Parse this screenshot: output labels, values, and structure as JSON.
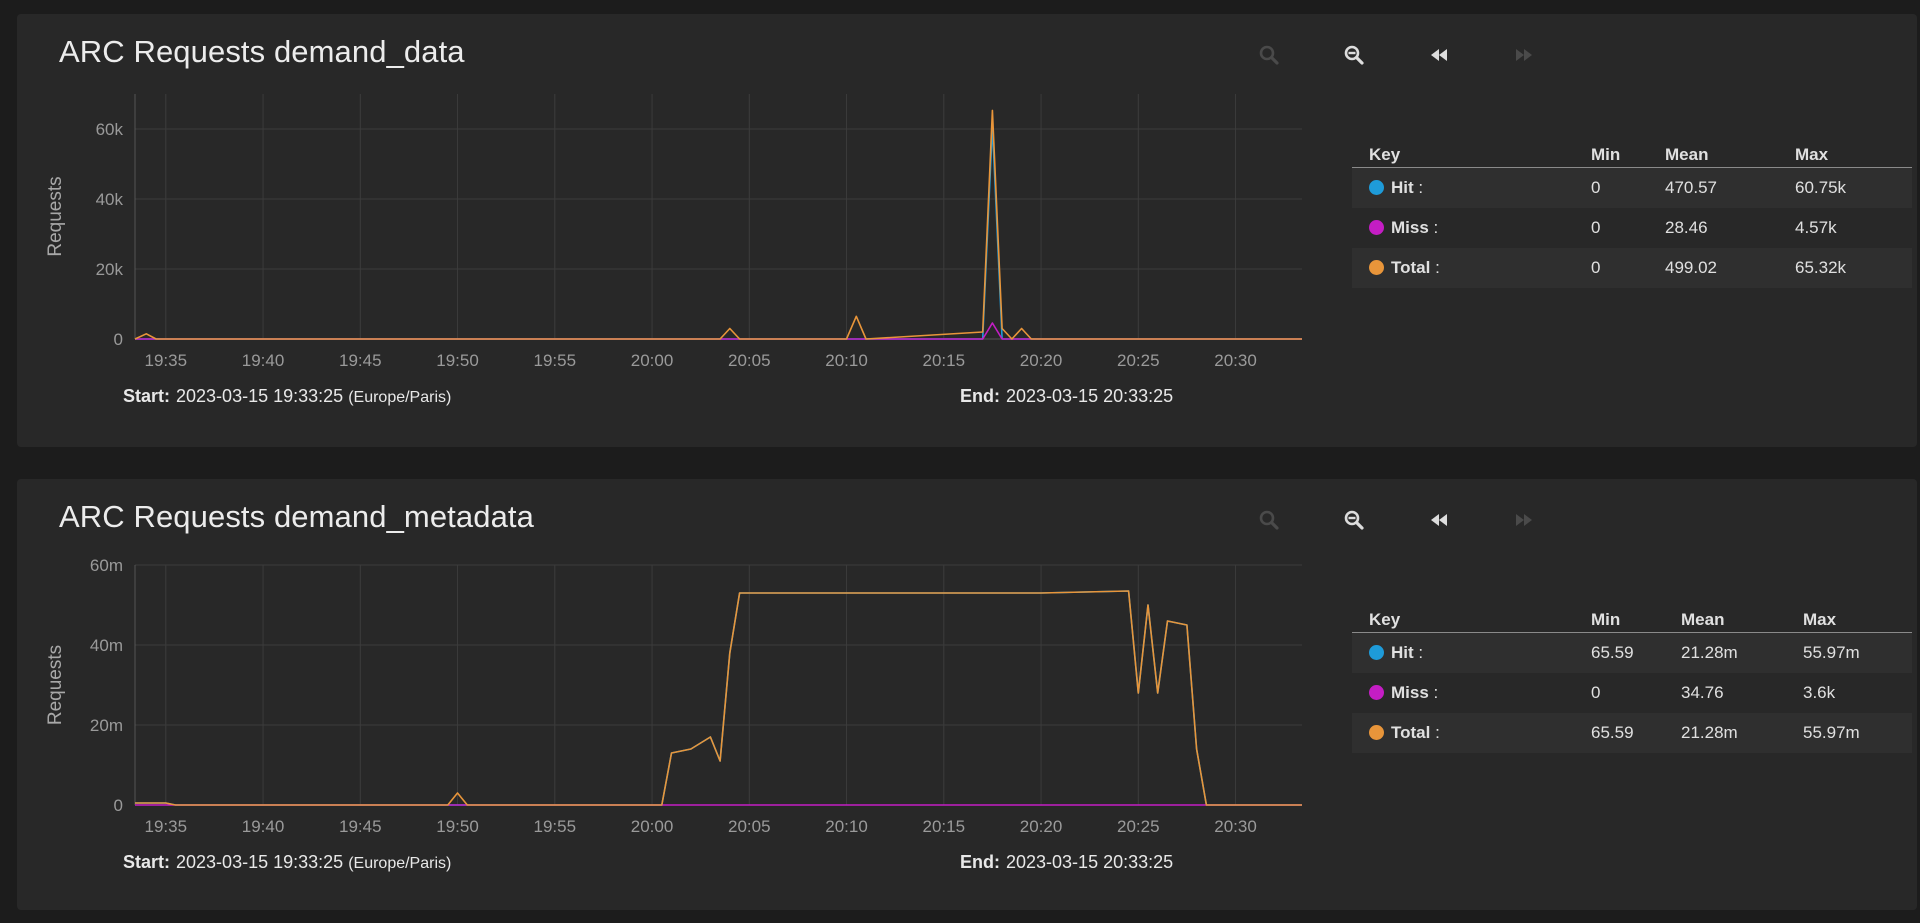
{
  "colors": {
    "hit": "#1e9bd9",
    "miss": "#c41dc4",
    "total": "#e8953a",
    "grid": "#3c3c3c",
    "axis": "#555555"
  },
  "charts": [
    {
      "title": "ARC Requests demand_data",
      "ylabel": "Requests",
      "start_label": "Start:",
      "start": "2023-03-15 19:33:25",
      "timezone": "(Europe/Paris)",
      "end_label": "End:",
      "end": "2023-03-15 20:33:25",
      "legend": {
        "headers": [
          "Key",
          "Min",
          "Mean",
          "Max"
        ],
        "rows": [
          {
            "name": "Hit",
            "min": "0",
            "mean": "470.57",
            "max": "60.75k"
          },
          {
            "name": "Miss",
            "min": "0",
            "mean": "28.46",
            "max": "4.57k"
          },
          {
            "name": "Total",
            "min": "0",
            "mean": "499.02",
            "max": "65.32k"
          }
        ]
      }
    },
    {
      "title": "ARC Requests demand_metadata",
      "ylabel": "Requests",
      "start_label": "Start:",
      "start": "2023-03-15 19:33:25",
      "timezone": "(Europe/Paris)",
      "end_label": "End:",
      "end": "2023-03-15 20:33:25",
      "legend": {
        "headers": [
          "Key",
          "Min",
          "Mean",
          "Max"
        ],
        "rows": [
          {
            "name": "Hit",
            "min": "65.59",
            "mean": "21.28m",
            "max": "55.97m"
          },
          {
            "name": "Miss",
            "min": "0",
            "mean": "34.76",
            "max": "3.6k"
          },
          {
            "name": "Total",
            "min": "65.59",
            "mean": "21.28m",
            "max": "55.97m"
          }
        ]
      }
    }
  ],
  "chart_data": [
    {
      "type": "line",
      "title": "ARC Requests demand_data",
      "ylabel": "Requests",
      "x_range": [
        "19:33:25",
        "20:33:25"
      ],
      "ylim": [
        0,
        70000
      ],
      "yticks": [
        0,
        20000,
        40000,
        60000
      ],
      "ytick_labels": [
        "0",
        "20k",
        "40k",
        "60k"
      ],
      "xtick_labels": [
        "19:35",
        "19:40",
        "19:45",
        "19:50",
        "19:55",
        "20:00",
        "20:05",
        "20:10",
        "20:15",
        "20:20",
        "20:25",
        "20:30"
      ],
      "grid": true,
      "series": [
        {
          "name": "Hit",
          "points": [
            [
              "19:33:25",
              0
            ],
            [
              "20:17:00",
              0
            ],
            [
              "20:17:30",
              60750
            ],
            [
              "20:18:00",
              0
            ],
            [
              "20:33:25",
              0
            ]
          ]
        },
        {
          "name": "Miss",
          "points": [
            [
              "19:33:25",
              0
            ],
            [
              "20:17:00",
              0
            ],
            [
              "20:17:30",
              4570
            ],
            [
              "20:18:00",
              0
            ],
            [
              "20:33:25",
              0
            ]
          ]
        },
        {
          "name": "Total",
          "points": [
            [
              "19:33:25",
              0
            ],
            [
              "19:34:00",
              1500
            ],
            [
              "19:34:30",
              0
            ],
            [
              "20:03:30",
              0
            ],
            [
              "20:04:00",
              3000
            ],
            [
              "20:04:30",
              0
            ],
            [
              "20:10:00",
              0
            ],
            [
              "20:10:30",
              6500
            ],
            [
              "20:11:00",
              0
            ],
            [
              "20:17:00",
              2000
            ],
            [
              "20:17:30",
              65320
            ],
            [
              "20:18:00",
              3000
            ],
            [
              "20:18:30",
              0
            ],
            [
              "20:19:00",
              3000
            ],
            [
              "20:19:30",
              0
            ],
            [
              "20:33:25",
              0
            ]
          ]
        }
      ]
    },
    {
      "type": "line",
      "title": "ARC Requests demand_metadata",
      "ylabel": "Requests",
      "x_range": [
        "19:33:25",
        "20:33:25"
      ],
      "ylim": [
        0,
        60000000
      ],
      "yticks": [
        0,
        20000000,
        40000000,
        60000000
      ],
      "ytick_labels": [
        "0",
        "20m",
        "40m",
        "60m"
      ],
      "xtick_labels": [
        "19:35",
        "19:40",
        "19:45",
        "19:50",
        "19:55",
        "20:00",
        "20:05",
        "20:10",
        "20:15",
        "20:20",
        "20:25",
        "20:30"
      ],
      "grid": true,
      "series": [
        {
          "name": "Hit",
          "points": [
            [
              "19:33:25",
              500000
            ],
            [
              "19:35:00",
              500000
            ],
            [
              "19:35:30",
              0
            ],
            [
              "20:00:30",
              0
            ],
            [
              "20:01:00",
              13000000
            ],
            [
              "20:02:00",
              14000000
            ],
            [
              "20:03:00",
              17000000
            ],
            [
              "20:03:30",
              11000000
            ],
            [
              "20:04:00",
              38000000
            ],
            [
              "20:04:30",
              53000000
            ],
            [
              "20:10:00",
              53000000
            ],
            [
              "20:15:00",
              53000000
            ],
            [
              "20:20:00",
              53000000
            ],
            [
              "20:24:30",
              53500000
            ],
            [
              "20:25:00",
              28000000
            ],
            [
              "20:25:30",
              50000000
            ],
            [
              "20:26:00",
              28000000
            ],
            [
              "20:26:30",
              46000000
            ],
            [
              "20:27:30",
              45000000
            ],
            [
              "20:28:00",
              14000000
            ],
            [
              "20:28:30",
              0
            ],
            [
              "20:33:25",
              0
            ]
          ]
        },
        {
          "name": "Miss",
          "points": [
            [
              "19:33:25",
              0
            ],
            [
              "20:33:25",
              0
            ]
          ]
        },
        {
          "name": "Total",
          "points": [
            [
              "19:33:25",
              500000
            ],
            [
              "19:35:00",
              500000
            ],
            [
              "19:35:30",
              0
            ],
            [
              "19:49:30",
              0
            ],
            [
              "19:50:00",
              3000000
            ],
            [
              "19:50:30",
              0
            ],
            [
              "20:00:30",
              0
            ],
            [
              "20:01:00",
              13000000
            ],
            [
              "20:02:00",
              14000000
            ],
            [
              "20:03:00",
              17000000
            ],
            [
              "20:03:30",
              11000000
            ],
            [
              "20:04:00",
              38000000
            ],
            [
              "20:04:30",
              53000000
            ],
            [
              "20:10:00",
              53000000
            ],
            [
              "20:15:00",
              53000000
            ],
            [
              "20:20:00",
              53000000
            ],
            [
              "20:24:30",
              53500000
            ],
            [
              "20:25:00",
              28000000
            ],
            [
              "20:25:30",
              50000000
            ],
            [
              "20:26:00",
              28000000
            ],
            [
              "20:26:30",
              46000000
            ],
            [
              "20:27:30",
              45000000
            ],
            [
              "20:28:00",
              14000000
            ],
            [
              "20:28:30",
              0
            ],
            [
              "20:33:25",
              0
            ]
          ]
        }
      ]
    }
  ]
}
